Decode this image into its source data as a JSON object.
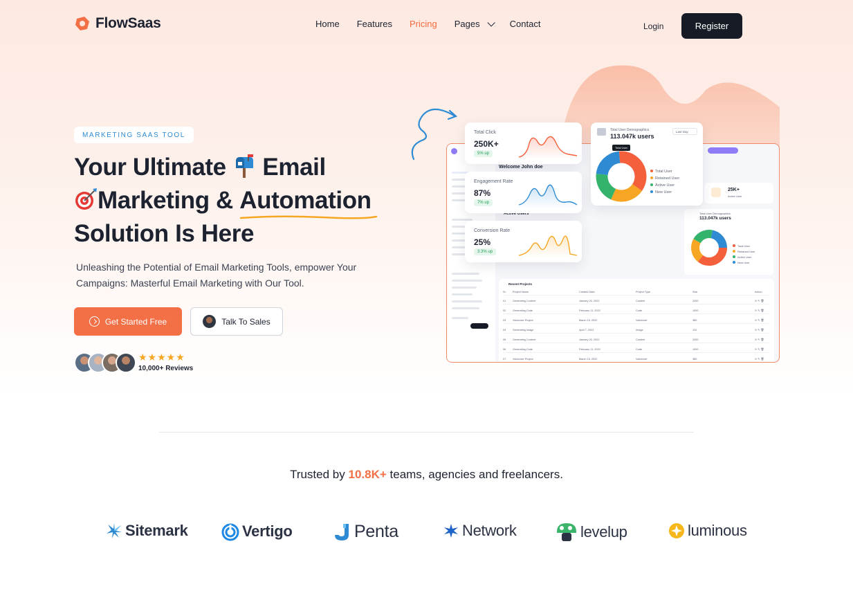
{
  "brand": {
    "name": "FlowSaas",
    "accent": "#f36f46",
    "dark": "#161b26"
  },
  "nav": {
    "items": [
      {
        "label": "Home",
        "active": false
      },
      {
        "label": "Features",
        "active": false
      },
      {
        "label": "Pricing",
        "active": true
      },
      {
        "label": "Pages",
        "active": false,
        "has_dropdown": true
      },
      {
        "label": "Contact",
        "active": false
      }
    ],
    "login": "Login",
    "register": "Register"
  },
  "hero": {
    "badge": "MARKETING SAAS TOOL",
    "headline_1": "Your Ultimate",
    "headline_2": "Email",
    "headline_3": "Marketing &",
    "headline_4": "Automation",
    "headline_5": "Solution Is Here",
    "subtitle": "Unleashing the Potential of Email Marketing Tools, empower Your Campaigns: Masterful Email Marketing with Our Tool.",
    "cta_primary": "Get Started Free",
    "cta_secondary": "Talk To Sales",
    "stars": "★★★★★",
    "reviews": "10,000+ Reviews"
  },
  "dashboard": {
    "welcome": "Welcome John doe",
    "total_click": {
      "title": "Total Click",
      "value": "250K+",
      "delta": "5% up"
    },
    "engagement": {
      "title": "Engagement Rate",
      "value": "87%",
      "delta": "7% up"
    },
    "conversion": {
      "title": "Conversion Rate",
      "value": "25%",
      "delta": "3.3% up"
    },
    "demographics": {
      "title": "Total User Demographics",
      "value": "113.047k users",
      "range": "Last Day",
      "tooltip": "Total User",
      "legend": [
        "Total User",
        "Retained User",
        "Active User",
        "New User"
      ],
      "colors": [
        "#f4603c",
        "#f6a623",
        "#33b36b",
        "#2e8bd3"
      ],
      "shares": [
        0.36,
        0.22,
        0.2,
        0.22
      ]
    },
    "active_users": "Active Users",
    "stat_25k": "25K+",
    "stat_25k_label": "Active User",
    "recent_projects": {
      "title": "Recent Projects",
      "columns": [
        "Sr.",
        "Project Name",
        "Created Date",
        "Project Type",
        "Size",
        "Action"
      ],
      "rows": [
        [
          "01",
          "Generating Content",
          "January 20, 2022",
          "Content",
          "2000"
        ],
        [
          "02",
          "Generating Code",
          "February 11, 2022",
          "Code",
          "1000"
        ],
        [
          "03",
          "Voiceover Project",
          "March 15, 2022",
          "Voiceover",
          "380"
        ],
        [
          "04",
          "Generating Image",
          "April 7, 2022",
          "Image",
          "110"
        ],
        [
          "05",
          "Generating Content",
          "January 20, 2022",
          "Content",
          "2000"
        ],
        [
          "06",
          "Generating Code",
          "February 11, 2022",
          "Code",
          "1000"
        ],
        [
          "07",
          "Voiceover Project",
          "March 15, 2022",
          "Voiceover",
          "380"
        ]
      ]
    }
  },
  "trusted": {
    "prefix": "Trusted by",
    "count": "10.8K+",
    "suffix": "teams, agencies and freelancers."
  },
  "logos": [
    {
      "name": "Sitemark",
      "icon": "sitemark-icon"
    },
    {
      "name": "Vertigo",
      "icon": "vertigo-icon"
    },
    {
      "name": "Penta",
      "icon": "penta-icon"
    },
    {
      "name": "Network",
      "icon": "network-icon"
    },
    {
      "name": "levelup",
      "icon": "levelup-icon"
    },
    {
      "name": "luminous",
      "icon": "luminous-icon"
    }
  ]
}
